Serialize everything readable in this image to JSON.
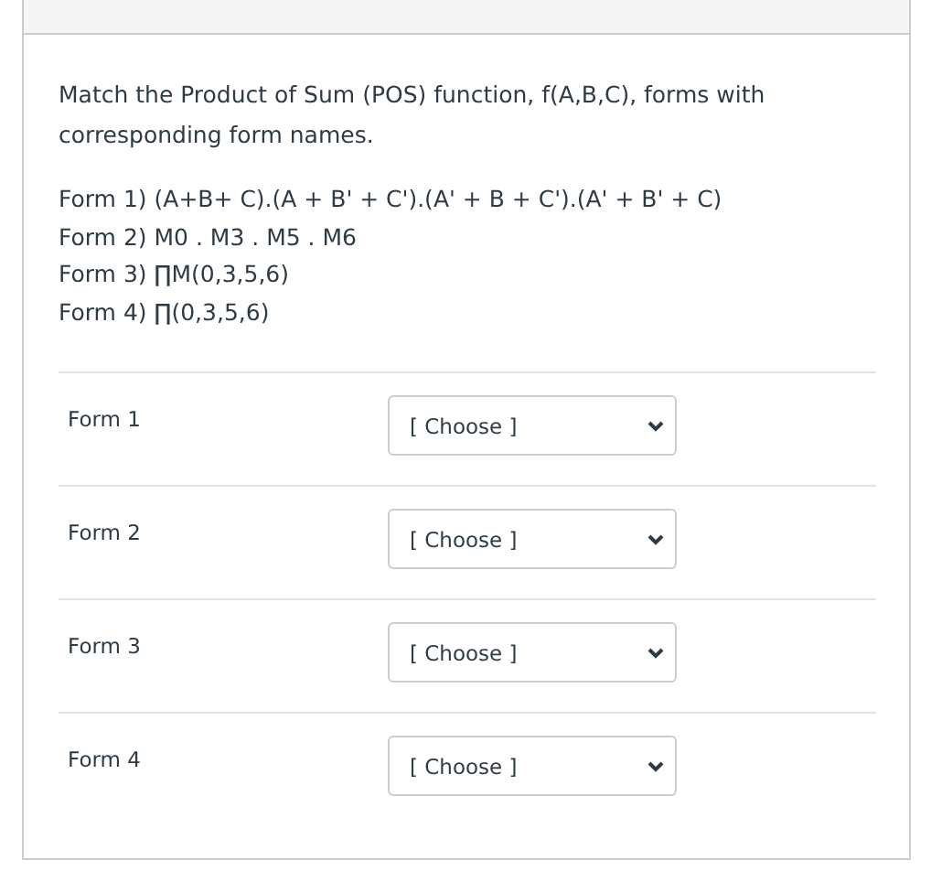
{
  "prompt": "Match the Product of Sum (POS) function, f(A,B,C), forms with corresponding form names.",
  "forms": [
    "Form 1) (A+B+ C).(A + B' + C').(A' + B + C').(A' + B' + C)",
    "Form 2) M0 . M3 . M5 . M6",
    "Form 3) ∏M(0,3,5,6)",
    "Form 4) ∏(0,3,5,6)"
  ],
  "matches": [
    {
      "label": "Form 1",
      "choice": "[ Choose ]"
    },
    {
      "label": "Form 2",
      "choice": "[ Choose ]"
    },
    {
      "label": "Form 3",
      "choice": "[ Choose ]"
    },
    {
      "label": "Form 4",
      "choice": "[ Choose ]"
    }
  ]
}
